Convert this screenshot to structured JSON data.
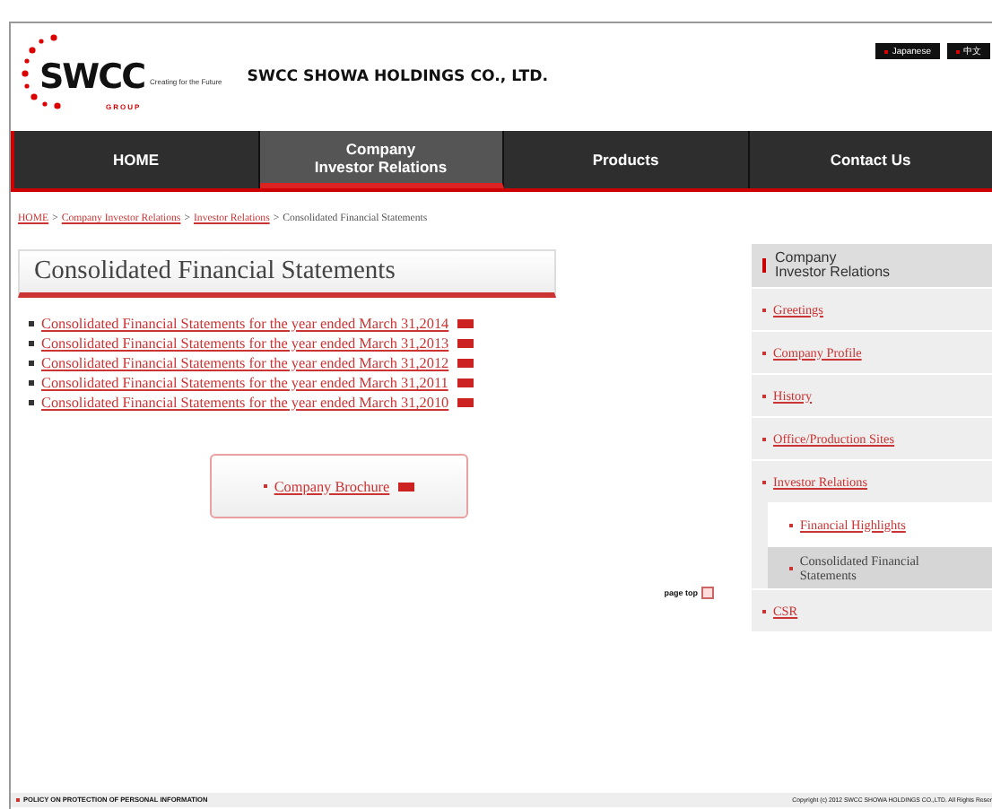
{
  "header": {
    "logo": {
      "mark": "SWCC",
      "tagline": "Creating for the Future",
      "group": "GROUP"
    },
    "company_name": "SWCC SHOWA HOLDINGS CO., LTD.",
    "languages": [
      "Japanese",
      "中文"
    ]
  },
  "nav": [
    {
      "label": "HOME",
      "selected": false
    },
    {
      "label": "Company\nInvestor Relations",
      "selected": true
    },
    {
      "label": "Products",
      "selected": false
    },
    {
      "label": "Contact Us",
      "selected": false
    }
  ],
  "breadcrumb": [
    {
      "label": "HOME",
      "link": true
    },
    {
      "sep": ">",
      "label": "Company Investor Relations",
      "link": true
    },
    {
      "sep": ">",
      "label": "Investor Relations",
      "link": true
    },
    {
      "sep": ">",
      "label": "Consolidated Financial Statements",
      "link": false
    }
  ],
  "page_title": "Consolidated Financial Statements",
  "documents": [
    "Consolidated Financial Statements for the year ended March 31,2014",
    "Consolidated Financial Statements for the year ended March 31,2013",
    "Consolidated Financial Statements for the year ended March 31,2012",
    "Consolidated Financial Statements for the year ended March 31,2011",
    "Consolidated Financial Statements for the year ended March 31,2010"
  ],
  "brochure": "Company Brochure",
  "page_top": "page top",
  "sidebar": {
    "title": "Company\nInvestor Relations",
    "items": [
      {
        "label": "Greetings",
        "selected": false
      },
      {
        "label": "Company Profile",
        "selected": false
      },
      {
        "label": "History",
        "selected": false
      },
      {
        "label": "Office/Production Sites",
        "selected": false
      },
      {
        "label": "Investor Relations",
        "selected": false,
        "children": [
          {
            "label": "Financial Highlights",
            "selected": false
          },
          {
            "label": "Consolidated Financial Statements",
            "selected": true
          }
        ]
      },
      {
        "label": "CSR",
        "selected": false
      }
    ]
  },
  "footer": {
    "policy": "POLICY ON PROTECTION OF PERSONAL INFORMATION",
    "copyright": "Copyright (c) 2012 SWCC SHOWA HOLDINGS CO.,LTD. All Rights Reser"
  }
}
